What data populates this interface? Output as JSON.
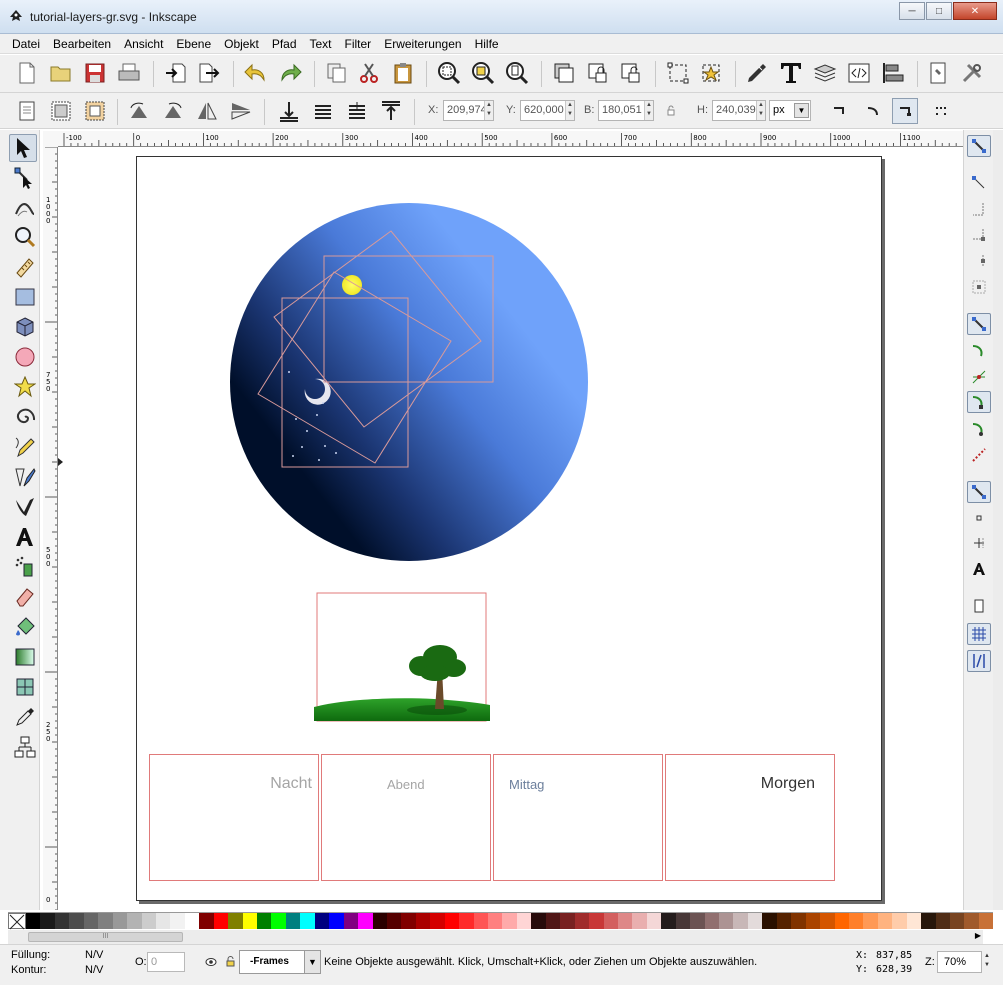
{
  "window": {
    "title": "tutorial-layers-gr.svg - Inkscape"
  },
  "menu": [
    "Datei",
    "Bearbeiten",
    "Ansicht",
    "Ebene",
    "Objekt",
    "Pfad",
    "Text",
    "Filter",
    "Erweiterungen",
    "Hilfe"
  ],
  "controls": {
    "x_label": "X:",
    "x_value": "209,974",
    "y_label": "Y:",
    "y_value": "620,000",
    "w_label": "B:",
    "w_value": "180,051",
    "h_label": "H:",
    "h_value": "240,039",
    "unit": "px"
  },
  "ruler": {
    "h_labels": [
      "-100",
      "0",
      "100",
      "200",
      "300",
      "400",
      "500",
      "600",
      "700",
      "800",
      "900",
      "1000",
      "1100"
    ],
    "v_labels": [
      "1000",
      "750",
      "500",
      "250",
      "0"
    ]
  },
  "drawing": {
    "frames": [
      {
        "label": "Nacht",
        "label_color": "#a5a5a5",
        "label_size": "16px"
      },
      {
        "label": "Abend",
        "label_color": "#a5a5a5",
        "label_size": "13px"
      },
      {
        "label": "Mittag",
        "label_color": "#6c7f9c",
        "label_size": "13px"
      },
      {
        "label": "Morgen",
        "label_color": "#333333",
        "label_size": "16px"
      }
    ],
    "sky_colors": [
      "#6fa2fa",
      "#000f2a"
    ],
    "grass_color": "#1f8f1a",
    "tree_color": "#1a6a12"
  },
  "palette": [
    "#000000",
    "#1a1a1a",
    "#333333",
    "#4d4d4d",
    "#666666",
    "#808080",
    "#999999",
    "#b3b3b3",
    "#cccccc",
    "#e6e6e6",
    "#f2f2f2",
    "#ffffff",
    "#800000",
    "#ff0000",
    "#808000",
    "#ffff00",
    "#008000",
    "#00ff00",
    "#008080",
    "#00ffff",
    "#000080",
    "#0000ff",
    "#800080",
    "#ff00ff",
    "#2b0000",
    "#550000",
    "#800000",
    "#aa0000",
    "#d40000",
    "#ff0000",
    "#ff2a2a",
    "#ff5555",
    "#ff8080",
    "#ffaaaa",
    "#ffd5d5",
    "#280b0b",
    "#501616",
    "#782121",
    "#a02c2c",
    "#c83737",
    "#d35f5f",
    "#de8787",
    "#e9afaf",
    "#f4d7d7",
    "#241c1c",
    "#483737",
    "#6c5353",
    "#916f6f",
    "#ac9393",
    "#c8b7b7",
    "#e3dbdb",
    "#2b1100",
    "#552200",
    "#803300",
    "#aa4400",
    "#d45500",
    "#ff6600",
    "#ff7f2a",
    "#ff9955",
    "#ffb380",
    "#ffccaa",
    "#ffe6d5",
    "#28170b",
    "#502d16",
    "#784421",
    "#a05a2c",
    "#c87137"
  ],
  "status": {
    "fill_label": "Füllung:",
    "fill_value": "N/V",
    "stroke_label": "Kontur:",
    "stroke_value": "N/V",
    "opacity_label": "O:",
    "opacity_value": "0",
    "layer": "-Frames",
    "message": "Keine Objekte ausgewählt. Klick, Umschalt+Klick, oder Ziehen um Objekte auszuwählen.",
    "cursor_x_label": "X:",
    "cursor_x": "837,85",
    "cursor_y_label": "Y:",
    "cursor_y": "628,39",
    "zoom_label": "Z:",
    "zoom": "70%"
  }
}
